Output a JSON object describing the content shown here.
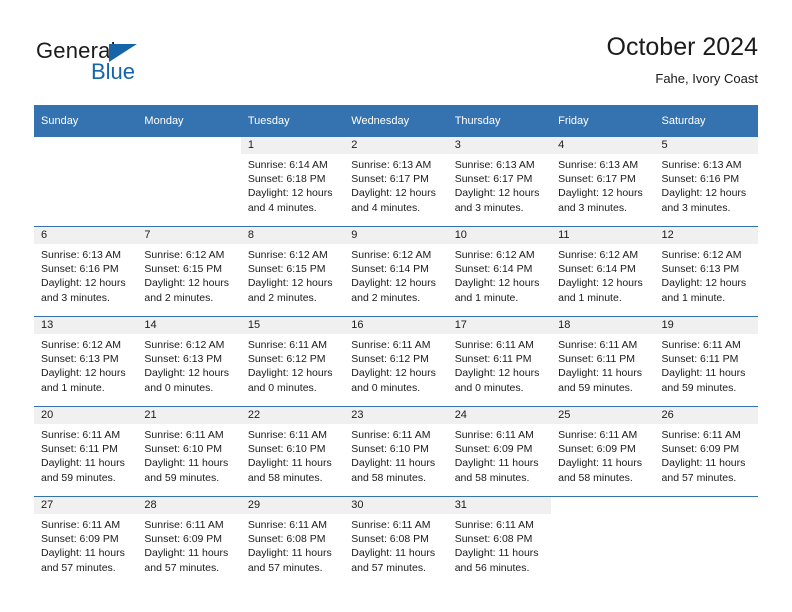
{
  "brand": {
    "line1": "General",
    "line2": "Blue",
    "accent_color": "#1565a8"
  },
  "header": {
    "title": "October 2024",
    "location": "Fahe, Ivory Coast"
  },
  "theme": {
    "header_blue": "#3572b0",
    "daynum_band": "#f0f0f0",
    "text": "#1b1b1b"
  },
  "weekdays": [
    "Sunday",
    "Monday",
    "Tuesday",
    "Wednesday",
    "Thursday",
    "Friday",
    "Saturday"
  ],
  "labels": {
    "sunrise": "Sunrise:",
    "sunset": "Sunset:",
    "daylight": "Daylight:"
  },
  "weeks": [
    [
      {
        "day": "",
        "sunrise": "",
        "sunset": "",
        "daylight": ""
      },
      {
        "day": "",
        "sunrise": "",
        "sunset": "",
        "daylight": ""
      },
      {
        "day": "1",
        "sunrise": "Sunrise: 6:14 AM",
        "sunset": "Sunset: 6:18 PM",
        "daylight": "Daylight: 12 hours and 4 minutes."
      },
      {
        "day": "2",
        "sunrise": "Sunrise: 6:13 AM",
        "sunset": "Sunset: 6:17 PM",
        "daylight": "Daylight: 12 hours and 4 minutes."
      },
      {
        "day": "3",
        "sunrise": "Sunrise: 6:13 AM",
        "sunset": "Sunset: 6:17 PM",
        "daylight": "Daylight: 12 hours and 3 minutes."
      },
      {
        "day": "4",
        "sunrise": "Sunrise: 6:13 AM",
        "sunset": "Sunset: 6:17 PM",
        "daylight": "Daylight: 12 hours and 3 minutes."
      },
      {
        "day": "5",
        "sunrise": "Sunrise: 6:13 AM",
        "sunset": "Sunset: 6:16 PM",
        "daylight": "Daylight: 12 hours and 3 minutes."
      }
    ],
    [
      {
        "day": "6",
        "sunrise": "Sunrise: 6:13 AM",
        "sunset": "Sunset: 6:16 PM",
        "daylight": "Daylight: 12 hours and 3 minutes."
      },
      {
        "day": "7",
        "sunrise": "Sunrise: 6:12 AM",
        "sunset": "Sunset: 6:15 PM",
        "daylight": "Daylight: 12 hours and 2 minutes."
      },
      {
        "day": "8",
        "sunrise": "Sunrise: 6:12 AM",
        "sunset": "Sunset: 6:15 PM",
        "daylight": "Daylight: 12 hours and 2 minutes."
      },
      {
        "day": "9",
        "sunrise": "Sunrise: 6:12 AM",
        "sunset": "Sunset: 6:14 PM",
        "daylight": "Daylight: 12 hours and 2 minutes."
      },
      {
        "day": "10",
        "sunrise": "Sunrise: 6:12 AM",
        "sunset": "Sunset: 6:14 PM",
        "daylight": "Daylight: 12 hours and 1 minute."
      },
      {
        "day": "11",
        "sunrise": "Sunrise: 6:12 AM",
        "sunset": "Sunset: 6:14 PM",
        "daylight": "Daylight: 12 hours and 1 minute."
      },
      {
        "day": "12",
        "sunrise": "Sunrise: 6:12 AM",
        "sunset": "Sunset: 6:13 PM",
        "daylight": "Daylight: 12 hours and 1 minute."
      }
    ],
    [
      {
        "day": "13",
        "sunrise": "Sunrise: 6:12 AM",
        "sunset": "Sunset: 6:13 PM",
        "daylight": "Daylight: 12 hours and 1 minute."
      },
      {
        "day": "14",
        "sunrise": "Sunrise: 6:12 AM",
        "sunset": "Sunset: 6:13 PM",
        "daylight": "Daylight: 12 hours and 0 minutes."
      },
      {
        "day": "15",
        "sunrise": "Sunrise: 6:11 AM",
        "sunset": "Sunset: 6:12 PM",
        "daylight": "Daylight: 12 hours and 0 minutes."
      },
      {
        "day": "16",
        "sunrise": "Sunrise: 6:11 AM",
        "sunset": "Sunset: 6:12 PM",
        "daylight": "Daylight: 12 hours and 0 minutes."
      },
      {
        "day": "17",
        "sunrise": "Sunrise: 6:11 AM",
        "sunset": "Sunset: 6:11 PM",
        "daylight": "Daylight: 12 hours and 0 minutes."
      },
      {
        "day": "18",
        "sunrise": "Sunrise: 6:11 AM",
        "sunset": "Sunset: 6:11 PM",
        "daylight": "Daylight: 11 hours and 59 minutes."
      },
      {
        "day": "19",
        "sunrise": "Sunrise: 6:11 AM",
        "sunset": "Sunset: 6:11 PM",
        "daylight": "Daylight: 11 hours and 59 minutes."
      }
    ],
    [
      {
        "day": "20",
        "sunrise": "Sunrise: 6:11 AM",
        "sunset": "Sunset: 6:11 PM",
        "daylight": "Daylight: 11 hours and 59 minutes."
      },
      {
        "day": "21",
        "sunrise": "Sunrise: 6:11 AM",
        "sunset": "Sunset: 6:10 PM",
        "daylight": "Daylight: 11 hours and 59 minutes."
      },
      {
        "day": "22",
        "sunrise": "Sunrise: 6:11 AM",
        "sunset": "Sunset: 6:10 PM",
        "daylight": "Daylight: 11 hours and 58 minutes."
      },
      {
        "day": "23",
        "sunrise": "Sunrise: 6:11 AM",
        "sunset": "Sunset: 6:10 PM",
        "daylight": "Daylight: 11 hours and 58 minutes."
      },
      {
        "day": "24",
        "sunrise": "Sunrise: 6:11 AM",
        "sunset": "Sunset: 6:09 PM",
        "daylight": "Daylight: 11 hours and 58 minutes."
      },
      {
        "day": "25",
        "sunrise": "Sunrise: 6:11 AM",
        "sunset": "Sunset: 6:09 PM",
        "daylight": "Daylight: 11 hours and 58 minutes."
      },
      {
        "day": "26",
        "sunrise": "Sunrise: 6:11 AM",
        "sunset": "Sunset: 6:09 PM",
        "daylight": "Daylight: 11 hours and 57 minutes."
      }
    ],
    [
      {
        "day": "27",
        "sunrise": "Sunrise: 6:11 AM",
        "sunset": "Sunset: 6:09 PM",
        "daylight": "Daylight: 11 hours and 57 minutes."
      },
      {
        "day": "28",
        "sunrise": "Sunrise: 6:11 AM",
        "sunset": "Sunset: 6:09 PM",
        "daylight": "Daylight: 11 hours and 57 minutes."
      },
      {
        "day": "29",
        "sunrise": "Sunrise: 6:11 AM",
        "sunset": "Sunset: 6:08 PM",
        "daylight": "Daylight: 11 hours and 57 minutes."
      },
      {
        "day": "30",
        "sunrise": "Sunrise: 6:11 AM",
        "sunset": "Sunset: 6:08 PM",
        "daylight": "Daylight: 11 hours and 57 minutes."
      },
      {
        "day": "31",
        "sunrise": "Sunrise: 6:11 AM",
        "sunset": "Sunset: 6:08 PM",
        "daylight": "Daylight: 11 hours and 56 minutes."
      },
      {
        "day": "",
        "sunrise": "",
        "sunset": "",
        "daylight": ""
      },
      {
        "day": "",
        "sunrise": "",
        "sunset": "",
        "daylight": ""
      }
    ]
  ]
}
